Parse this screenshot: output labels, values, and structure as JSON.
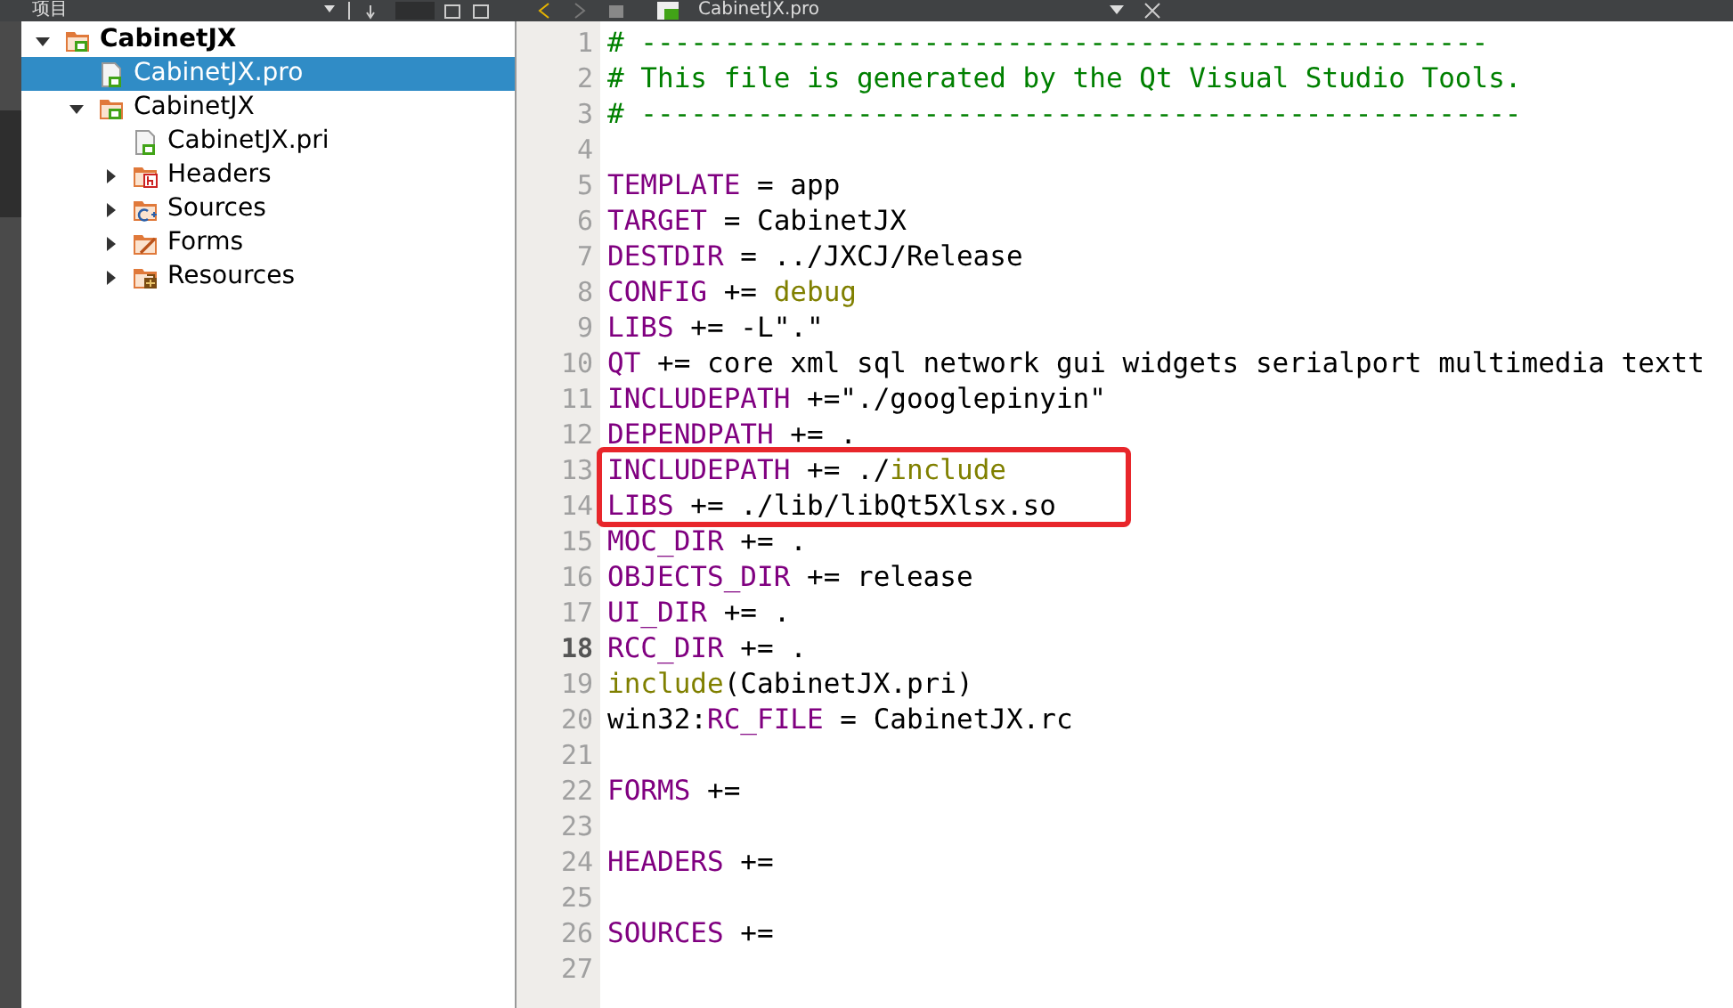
{
  "project_panel": {
    "title": "项目"
  },
  "project_tree": [
    {
      "label": "CabinetJX",
      "kind": "project",
      "bold": true,
      "selected": false,
      "expanded": true,
      "children": [
        {
          "label": "CabinetJX.pro",
          "kind": "qtfile",
          "bold": false,
          "selected": true
        },
        {
          "label": "CabinetJX",
          "kind": "project",
          "bold": false,
          "selected": false,
          "expanded": true,
          "children": [
            {
              "label": "CabinetJX.pri",
              "kind": "qtfile",
              "bold": false,
              "selected": false
            },
            {
              "label": "Headers",
              "kind": "headers",
              "bold": false,
              "selected": false,
              "expanded": false
            },
            {
              "label": "Sources",
              "kind": "sources",
              "bold": false,
              "selected": false,
              "expanded": false
            },
            {
              "label": "Forms",
              "kind": "forms",
              "bold": false,
              "selected": false,
              "expanded": false
            },
            {
              "label": "Resources",
              "kind": "resources",
              "bold": false,
              "selected": false,
              "expanded": false
            }
          ]
        }
      ]
    }
  ],
  "editor": {
    "tab_title": "CabinetJX.pro",
    "lines": [
      {
        "number": "1",
        "current": false,
        "changed": false,
        "tokens": [
          {
            "kind": "comment",
            "text": "# ---------------------------------------------------"
          }
        ]
      },
      {
        "number": "2",
        "current": false,
        "changed": false,
        "tokens": [
          {
            "kind": "comment",
            "text": "# This file is generated by the Qt Visual Studio Tools."
          }
        ]
      },
      {
        "number": "3",
        "current": false,
        "changed": false,
        "tokens": [
          {
            "kind": "comment",
            "text": "# -----------------------------------------------------"
          }
        ]
      },
      {
        "number": "4",
        "current": false,
        "changed": false
      },
      {
        "number": "5",
        "current": false,
        "changed": false,
        "tokens": [
          {
            "kind": "keyword",
            "text": "TEMPLATE"
          },
          {
            "kind": "plain",
            "text": " = app"
          }
        ]
      },
      {
        "number": "6",
        "current": false,
        "changed": false,
        "tokens": [
          {
            "kind": "keyword",
            "text": "TARGET"
          },
          {
            "kind": "plain",
            "text": " = CabinetJX"
          }
        ]
      },
      {
        "number": "7",
        "current": false,
        "changed": false,
        "tokens": [
          {
            "kind": "keyword",
            "text": "DESTDIR"
          },
          {
            "kind": "plain",
            "text": " = ../JXCJ/Release"
          }
        ]
      },
      {
        "number": "8",
        "current": false,
        "changed": false,
        "tokens": [
          {
            "kind": "keyword",
            "text": "CONFIG"
          },
          {
            "kind": "plain",
            "text": " += "
          },
          {
            "kind": "value",
            "text": "debug"
          }
        ]
      },
      {
        "number": "9",
        "current": false,
        "changed": false,
        "tokens": [
          {
            "kind": "keyword",
            "text": "LIBS"
          },
          {
            "kind": "plain",
            "text": " += -L\".\""
          }
        ]
      },
      {
        "number": "10",
        "current": false,
        "changed": false,
        "tokens": [
          {
            "kind": "keyword",
            "text": "QT"
          },
          {
            "kind": "plain",
            "text": " += core xml sql network gui widgets serialport multimedia textt"
          }
        ]
      },
      {
        "number": "11",
        "current": false,
        "changed": false,
        "tokens": [
          {
            "kind": "keyword",
            "text": "INCLUDEPATH"
          },
          {
            "kind": "plain",
            "text": " +=\"./googlepinyin\""
          }
        ]
      },
      {
        "number": "12",
        "current": false,
        "changed": false,
        "tokens": [
          {
            "kind": "keyword",
            "text": "DEPENDPATH"
          },
          {
            "kind": "plain",
            "text": " += ."
          }
        ]
      },
      {
        "number": "13",
        "current": false,
        "changed": true,
        "tokens": [
          {
            "kind": "keyword",
            "text": "INCLUDEPATH"
          },
          {
            "kind": "plain",
            "text": " += ./"
          },
          {
            "kind": "value",
            "text": "include"
          }
        ]
      },
      {
        "number": "14",
        "current": false,
        "changed": true,
        "tokens": [
          {
            "kind": "keyword",
            "text": "LIBS"
          },
          {
            "kind": "plain",
            "text": " += ./lib/libQt5Xlsx.so"
          }
        ]
      },
      {
        "number": "15",
        "current": false,
        "changed": false,
        "tokens": [
          {
            "kind": "keyword",
            "text": "MOC_DIR"
          },
          {
            "kind": "plain",
            "text": " += ."
          }
        ]
      },
      {
        "number": "16",
        "current": false,
        "changed": false,
        "tokens": [
          {
            "kind": "keyword",
            "text": "OBJECTS_DIR"
          },
          {
            "kind": "plain",
            "text": " += release"
          }
        ]
      },
      {
        "number": "17",
        "current": false,
        "changed": false,
        "tokens": [
          {
            "kind": "keyword",
            "text": "UI_DIR"
          },
          {
            "kind": "plain",
            "text": " += ."
          }
        ]
      },
      {
        "number": "18",
        "current": true,
        "changed": false,
        "tokens": [
          {
            "kind": "keyword",
            "text": "RCC_DIR"
          },
          {
            "kind": "plain",
            "text": " += ."
          }
        ]
      },
      {
        "number": "19",
        "current": false,
        "changed": false,
        "tokens": [
          {
            "kind": "value",
            "text": "include"
          },
          {
            "kind": "plain",
            "text": "(CabinetJX.pri)"
          }
        ]
      },
      {
        "number": "20",
        "current": false,
        "changed": false,
        "tokens": [
          {
            "kind": "plain",
            "text": "win32:"
          },
          {
            "kind": "keyword",
            "text": "RC_FILE"
          },
          {
            "kind": "plain",
            "text": " = CabinetJX.rc"
          }
        ]
      },
      {
        "number": "21",
        "current": false,
        "changed": false
      },
      {
        "number": "22",
        "current": false,
        "changed": false,
        "tokens": [
          {
            "kind": "keyword",
            "text": "FORMS"
          },
          {
            "kind": "plain",
            "text": " +="
          }
        ]
      },
      {
        "number": "23",
        "current": false,
        "changed": false
      },
      {
        "number": "24",
        "current": false,
        "changed": false,
        "tokens": [
          {
            "kind": "keyword",
            "text": "HEADERS"
          },
          {
            "kind": "plain",
            "text": " +="
          }
        ]
      },
      {
        "number": "25",
        "current": false,
        "changed": false
      },
      {
        "number": "26",
        "current": false,
        "changed": false,
        "tokens": [
          {
            "kind": "keyword",
            "text": "SOURCES"
          },
          {
            "kind": "plain",
            "text": " +="
          }
        ]
      },
      {
        "number": "27",
        "current": false,
        "changed": false
      }
    ]
  }
}
